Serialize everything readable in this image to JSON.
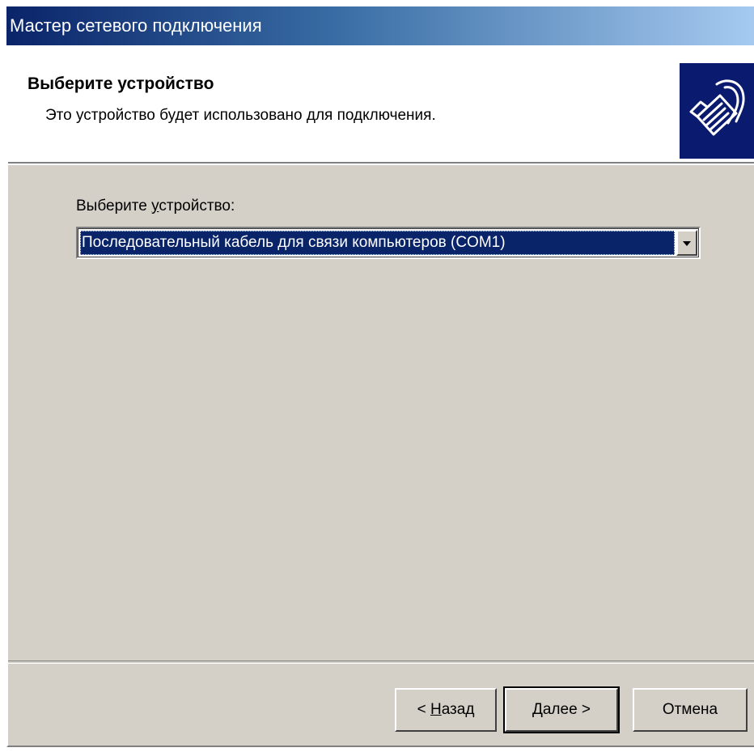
{
  "window": {
    "title": "Мастер сетевого подключения"
  },
  "header": {
    "title": "Выберите устройство",
    "subtitle": "Это устройство будет использовано для подключения.",
    "icon": "network-cable-icon"
  },
  "device": {
    "label_prefix": "Выберите ",
    "label_accel": "у",
    "label_suffix": "стройство:",
    "selected": "Последовательный кабель для связи компьютеров (COM1)"
  },
  "buttons": {
    "back_prefix": "< ",
    "back_accel": "Н",
    "back_suffix": "азад",
    "next": "Далее >",
    "cancel": "Отмена"
  },
  "colors": {
    "title_gradient_start": "#0a246a",
    "title_gradient_end": "#a6caf0",
    "dialog_background": "#d4d0c8",
    "selection": "#0a246a",
    "icon_background": "#0a1a6e"
  }
}
